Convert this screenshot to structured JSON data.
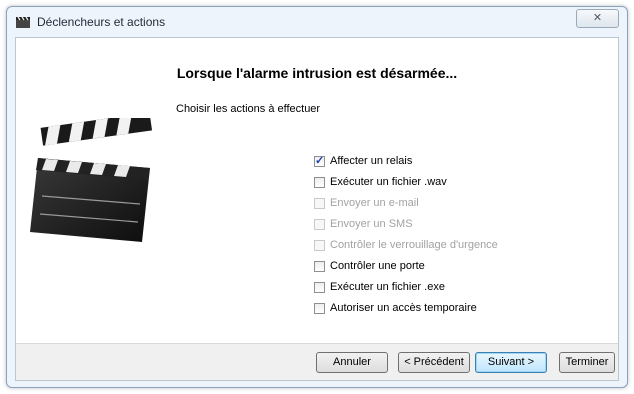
{
  "window": {
    "title": "Déclencheurs et actions",
    "close_glyph": "✕",
    "icon": "clapperboard-icon"
  },
  "content": {
    "heading": "Lorsque l'alarme intrusion est désarmée...",
    "subtitle": "Choisir les actions à effectuer",
    "illustration": "clapperboard-icon"
  },
  "options": [
    {
      "label": "Affecter un relais",
      "checked": true,
      "enabled": true
    },
    {
      "label": "Exécuter un fichier .wav",
      "checked": false,
      "enabled": true
    },
    {
      "label": "Envoyer un e-mail",
      "checked": false,
      "enabled": false
    },
    {
      "label": "Envoyer un SMS",
      "checked": false,
      "enabled": false
    },
    {
      "label": "Contrôler le verrouillage d'urgence",
      "checked": false,
      "enabled": false
    },
    {
      "label": "Contrôler une porte",
      "checked": false,
      "enabled": true
    },
    {
      "label": "Exécuter un fichier .exe",
      "checked": false,
      "enabled": true
    },
    {
      "label": "Autoriser un accès temporaire",
      "checked": false,
      "enabled": true
    }
  ],
  "buttons": {
    "cancel": "Annuler",
    "previous": "< Précédent",
    "next": "Suivant >",
    "finish": "Terminer"
  }
}
